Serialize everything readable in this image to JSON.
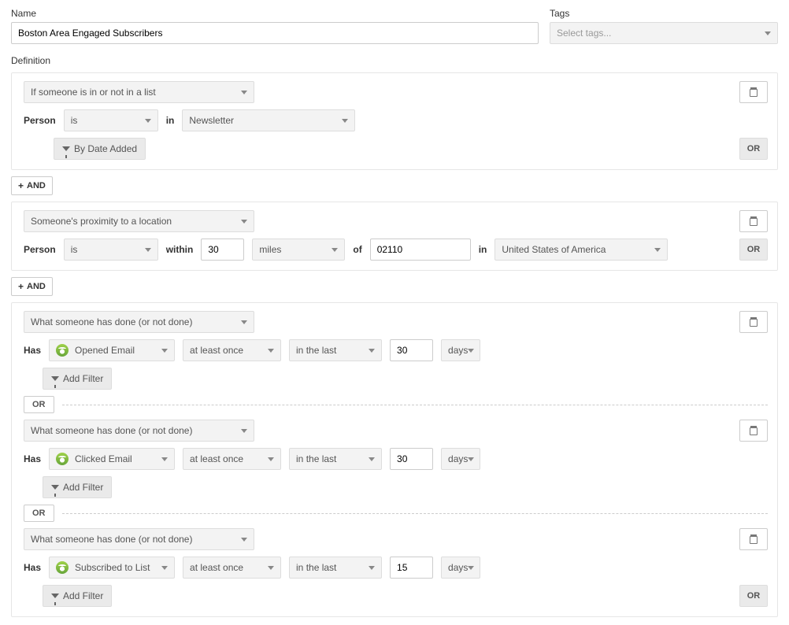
{
  "labels": {
    "name": "Name",
    "tags": "Tags",
    "definition": "Definition"
  },
  "nameValue": "Boston Area Engaged Subscribers",
  "tagsPlaceholder": "Select tags...",
  "buttons": {
    "byDateAdded": "By Date Added",
    "addFilter": "Add Filter",
    "and": "AND",
    "or": "OR"
  },
  "static": {
    "person": "Person",
    "has": "Has",
    "in": "in",
    "within": "within",
    "of": "of"
  },
  "block1": {
    "condition": "If someone is in or not in a list",
    "personOp": "is",
    "listName": "Newsletter"
  },
  "block2": {
    "condition": "Someone's proximity to a location",
    "personOp": "is",
    "distance": "30",
    "unit": "miles",
    "zip": "02110",
    "country": "United States of America"
  },
  "block3": {
    "condition": "What someone has done (or not done)",
    "sub1": {
      "event": "Opened Email",
      "freq": "at least once",
      "window": "in the last",
      "value": "30",
      "unit": "days"
    },
    "sub2": {
      "event": "Clicked Email",
      "freq": "at least once",
      "window": "in the last",
      "value": "30",
      "unit": "days"
    },
    "sub3": {
      "event": "Subscribed to List",
      "freq": "at least once",
      "window": "in the last",
      "value": "15",
      "unit": "days"
    }
  }
}
